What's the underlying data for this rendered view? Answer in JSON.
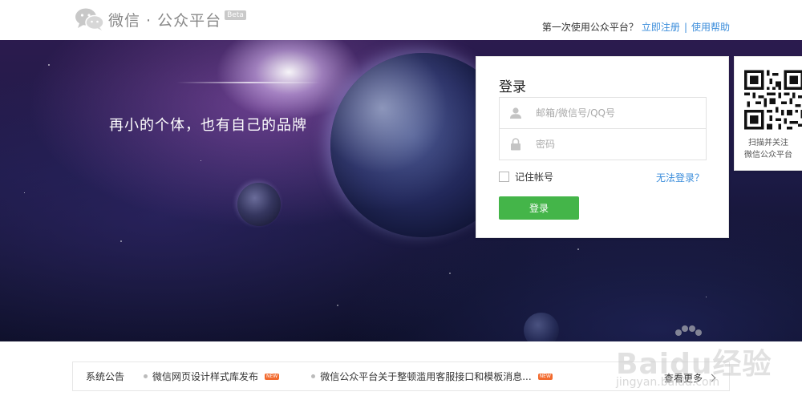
{
  "header": {
    "logo_title": "微信 · 公众平台",
    "beta": "Beta",
    "first_time_text": "第一次使用公众平台？",
    "register_link": "立即注册",
    "help_link": "使用帮助"
  },
  "banner": {
    "slogan": "再小的个体，也有自己的品牌"
  },
  "login": {
    "title": "登录",
    "username_placeholder": "邮箱/微信号/QQ号",
    "password_placeholder": "密码",
    "remember_label": "记住帐号",
    "forgot_link": "无法登录？",
    "submit_label": "登录"
  },
  "qr": {
    "caption_line1": "扫描并关注",
    "caption_line2": "微信公众平台"
  },
  "notice": {
    "label": "系统公告",
    "items": [
      {
        "text": "微信网页设计样式库发布",
        "badge": "NEW"
      },
      {
        "text": "微信公众平台关于整顿滥用客服接口和模板消息...",
        "badge": "NEW"
      }
    ],
    "more": "查看更多"
  },
  "watermark": {
    "text": "Baidu经验",
    "url": "jingyan.baidu.com"
  },
  "colors": {
    "link_blue": "#3b8ddb",
    "login_green": "#44b549",
    "new_badge": "#f26a2e"
  }
}
